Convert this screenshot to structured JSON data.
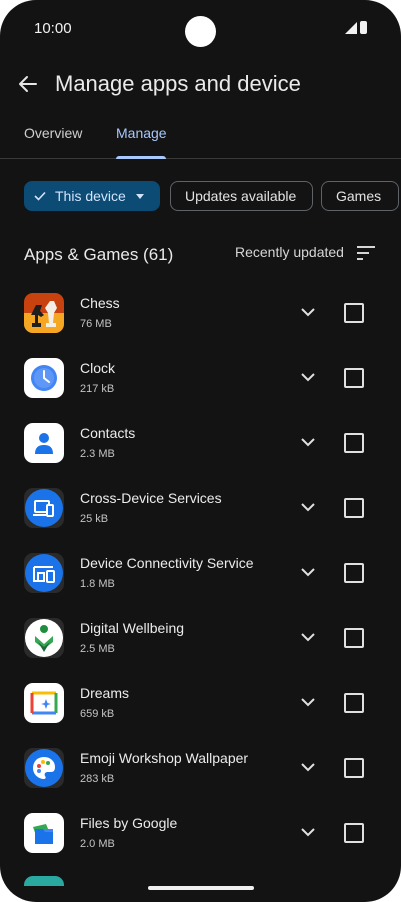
{
  "status_bar": {
    "time": "10:00"
  },
  "header": {
    "title": "Manage apps and device"
  },
  "tabs": [
    {
      "label": "Overview"
    },
    {
      "label": "Manage"
    }
  ],
  "filters": [
    {
      "label": "This device"
    },
    {
      "label": "Updates available"
    },
    {
      "label": "Games"
    }
  ],
  "section": {
    "title": "Apps & Games (61)",
    "sort_label": "Recently updated"
  },
  "apps": [
    {
      "name": "Chess",
      "size": "76 MB",
      "icon": "chess-icon"
    },
    {
      "name": "Clock",
      "size": "217 kB",
      "icon": "clock-icon"
    },
    {
      "name": "Contacts",
      "size": "2.3 MB",
      "icon": "contacts-icon"
    },
    {
      "name": "Cross-Device Services",
      "size": "25 kB",
      "icon": "cross-device-icon"
    },
    {
      "name": "Device Connectivity Service",
      "size": "1.8 MB",
      "icon": "device-connectivity-icon"
    },
    {
      "name": "Digital Wellbeing",
      "size": "2.5 MB",
      "icon": "digital-wellbeing-icon"
    },
    {
      "name": "Dreams",
      "size": "659 kB",
      "icon": "dreams-icon"
    },
    {
      "name": "Emoji Workshop Wallpaper",
      "size": "283 kB",
      "icon": "emoji-workshop-icon"
    },
    {
      "name": "Files by Google",
      "size": "2.0 MB",
      "icon": "files-icon"
    }
  ],
  "colors": {
    "accent": "#a8c7fa",
    "selected_chip_bg": "#0b4b74",
    "background": "#131313"
  }
}
